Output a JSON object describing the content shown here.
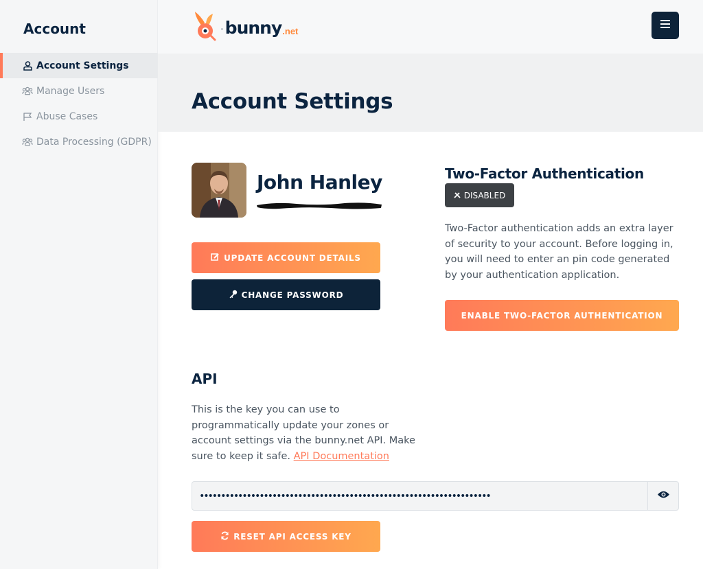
{
  "sidebar": {
    "title": "Account",
    "items": [
      {
        "label": "Account Settings",
        "icon": "user-icon",
        "active": true
      },
      {
        "label": "Manage Users",
        "icon": "users-icon",
        "active": false
      },
      {
        "label": "Abuse Cases",
        "icon": "flag-icon",
        "active": false
      },
      {
        "label": "Data Processing (GDPR)",
        "icon": "users-icon",
        "active": false
      }
    ]
  },
  "topbar": {
    "logo_text": "bunny",
    "logo_suffix": ".net",
    "menu_icon": "hamburger-icon"
  },
  "page": {
    "title": "Account Settings"
  },
  "profile": {
    "name": "John Hanley",
    "update_label": "UPDATE ACCOUNT DETAILS",
    "password_label": "CHANGE PASSWORD"
  },
  "two_factor": {
    "title": "Two-Factor Authentication",
    "status": "DISABLED",
    "description": "Two-Factor authentication adds an extra layer of security to your account. Before logging in, you will need to enter an pin code generated by your authentication application.",
    "enable_label": "ENABLE TWO-FACTOR AUTHENTICATION"
  },
  "api": {
    "title": "API",
    "description": "This is the key you can use to programmatically update your zones or account settings via the bunny.net API. Make sure to keep it safe.",
    "doc_link": "API Documentation",
    "key_value": "••••••••••••••••••••••••••••••••••••••••••••••••••••••••••••••••••••",
    "reset_label": "RESET API ACCESS KEY"
  },
  "colors": {
    "accent_start": "#ff7a59",
    "accent_end": "#ffa84f",
    "dark": "#0d2339",
    "badge": "#3d4145"
  }
}
